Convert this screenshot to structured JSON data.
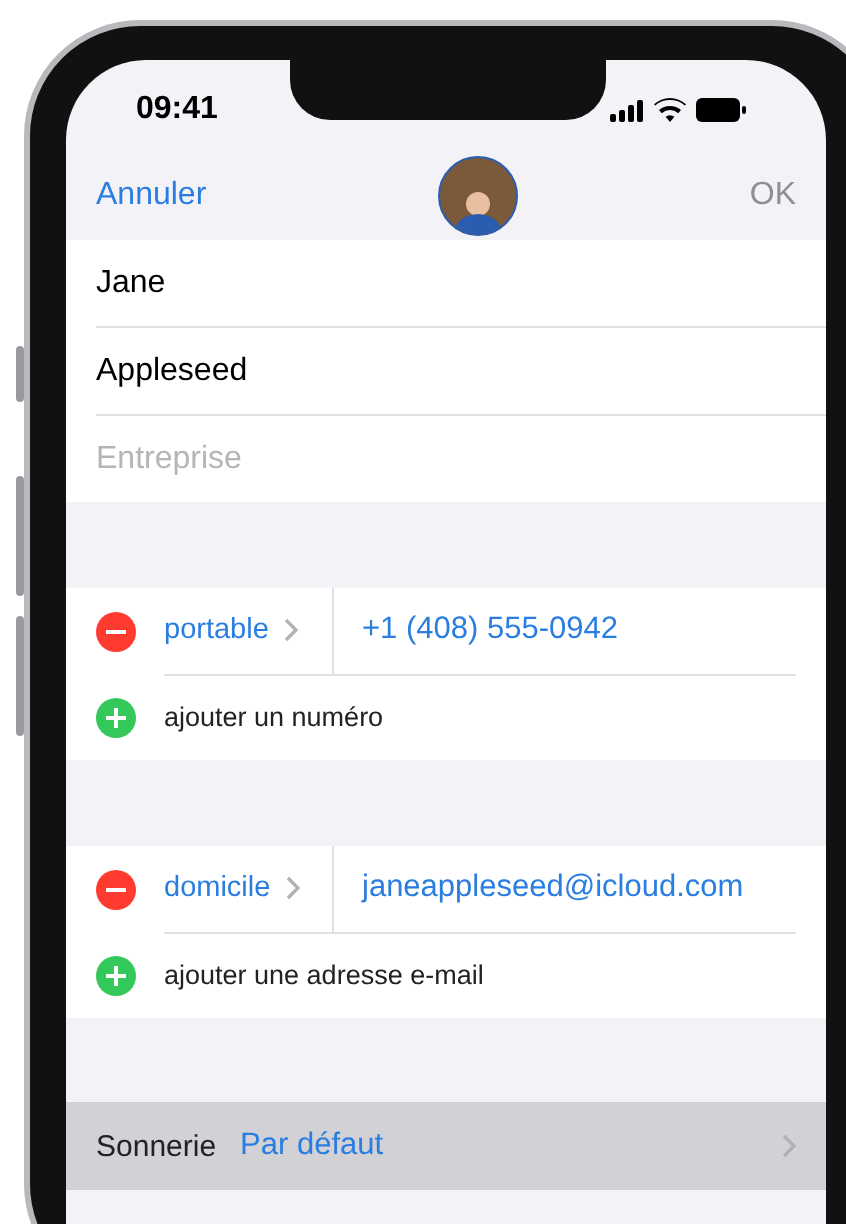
{
  "status_bar": {
    "time": "09:41"
  },
  "nav": {
    "cancel": "Annuler",
    "done": "OK",
    "done_disabled": true
  },
  "name_fields": [
    {
      "value": "Jane"
    },
    {
      "value": "Appleseed"
    },
    {
      "placeholder": "Entreprise"
    }
  ],
  "phones": {
    "items": [
      {
        "label": "portable",
        "value": "+1 (408) 555-0942"
      }
    ],
    "add": "ajouter un numéro"
  },
  "emails": {
    "items": [
      {
        "label": "domicile",
        "value": "janeappleseed@icloud.com"
      }
    ],
    "add": "ajouter une adresse e-mail"
  },
  "ringtone": {
    "label": "Sonnerie",
    "value": "Par défaut",
    "selected": true
  }
}
